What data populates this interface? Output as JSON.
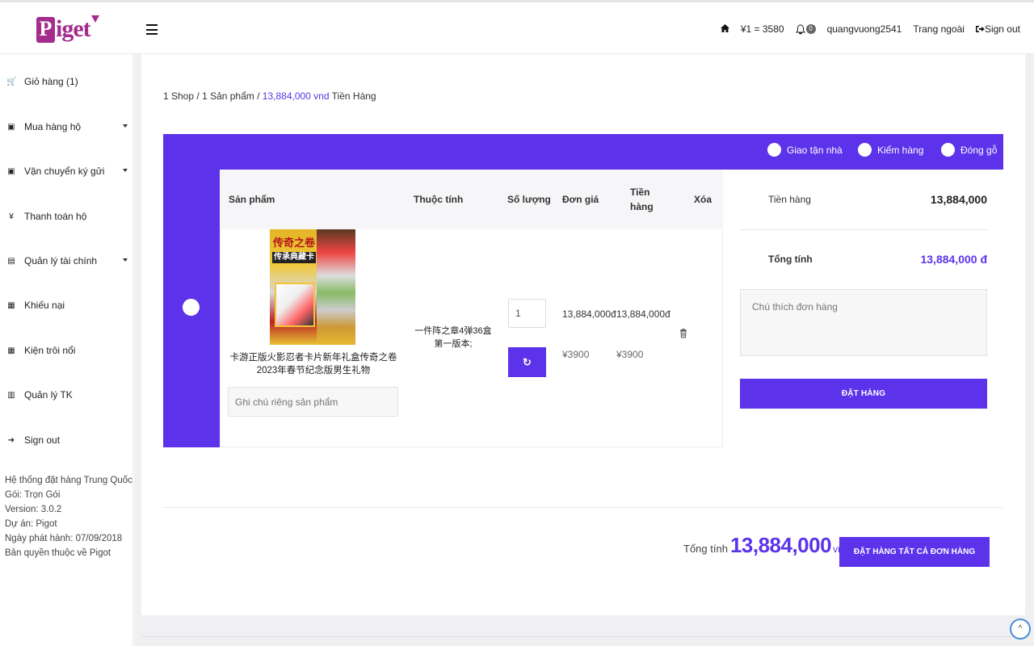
{
  "header": {
    "logo_p": "P",
    "logo_rest": "iget",
    "home_icon": "home-icon",
    "exchange_rate": "¥1 = 3580",
    "bell_count": "0",
    "username": "quangvuong2541",
    "outside_link": "Trang ngoài",
    "sign_out": "Sign out"
  },
  "sidebar": {
    "items": [
      {
        "label": "Giỏ hàng (1)",
        "icon": "cart-icon",
        "glyph": "🛒",
        "caret": false
      },
      {
        "label": "Mua hàng hộ",
        "icon": "copy-icon",
        "glyph": "▣",
        "caret": true
      },
      {
        "label": "Vận chuyển ký gửi",
        "icon": "copy-icon",
        "glyph": "▣",
        "caret": true
      },
      {
        "label": "Thanh toán hộ",
        "icon": "yen-icon",
        "glyph": "¥",
        "caret": false
      },
      {
        "label": "Quản lý tài chính",
        "icon": "money-icon",
        "glyph": "▤",
        "caret": true
      },
      {
        "label": "Khiếu nại",
        "icon": "grid-icon",
        "glyph": "▦",
        "caret": false
      },
      {
        "label": "Kiện trôi nổi",
        "icon": "grid-icon",
        "glyph": "▦",
        "caret": false
      },
      {
        "label": "Quản lý TK",
        "icon": "id-card-icon",
        "glyph": "▥",
        "caret": false
      },
      {
        "label": "Sign out",
        "icon": "sign-out-icon",
        "glyph": "➜",
        "caret": false
      }
    ],
    "info": [
      "Hệ thống đặt hàng Trung Quốc",
      "Gói: Trọn Gói",
      "Version: 3.0.2",
      "Dự án: Pigot",
      "Ngày phát hành: 07/09/2018",
      "Bản quyền thuộc về Pigot"
    ]
  },
  "breadcrumb": {
    "shop": "1 Shop",
    "sep1": " / ",
    "products": "1 Sản phẩm",
    "sep2": " / ",
    "amount": "13,884,000 vnd",
    "suffix": " Tiền Hàng"
  },
  "options": {
    "home_delivery": "Giao tận nhà",
    "inspection": "Kiểm hàng",
    "wood_packing": "Đóng gỗ"
  },
  "table": {
    "headers": {
      "product": "Sản phẩm",
      "attribute": "Thuộc tính",
      "quantity": "Số lượng",
      "unit_price": "Đơn giá",
      "amount_line1": "Tiền",
      "amount_line2": "hàng",
      "delete": "Xóa"
    },
    "row": {
      "image_title": "传奇之卷",
      "image_subtitle": "传承典藏卡",
      "product_name": "卡游正版火影忍者卡片新年礼盒传奇之卷2023年春节纪念版男生礼物",
      "note_placeholder": "Ghi chú riêng sản phẩm",
      "attribute": "一件阵之章4弹36盒第一版本;",
      "quantity": "1",
      "unit_price_vnd": "13,884,000đ",
      "amount_vnd": "13,884,000đ",
      "unit_price_cny": "¥3900",
      "amount_cny": "¥3900",
      "refresh_glyph": "↻"
    }
  },
  "summary": {
    "goods_label": "Tiền hàng",
    "goods_value": "13,884,000",
    "total_label": "Tổng tính",
    "total_value": "13,884,000 đ",
    "note_placeholder": "Chú thích đơn hàng",
    "order_button": "ĐẶT HÀNG"
  },
  "footer": {
    "total_label": "Tổng tính",
    "total_value": "13,884,000",
    "unit": "vnd",
    "order_all_button": "ĐẶT HÀNG TẤT CẢ ĐƠN HÀNG",
    "scroll_glyph": "^"
  },
  "colors": {
    "accent": "#5c33ea",
    "logo": "#a42c8c"
  }
}
